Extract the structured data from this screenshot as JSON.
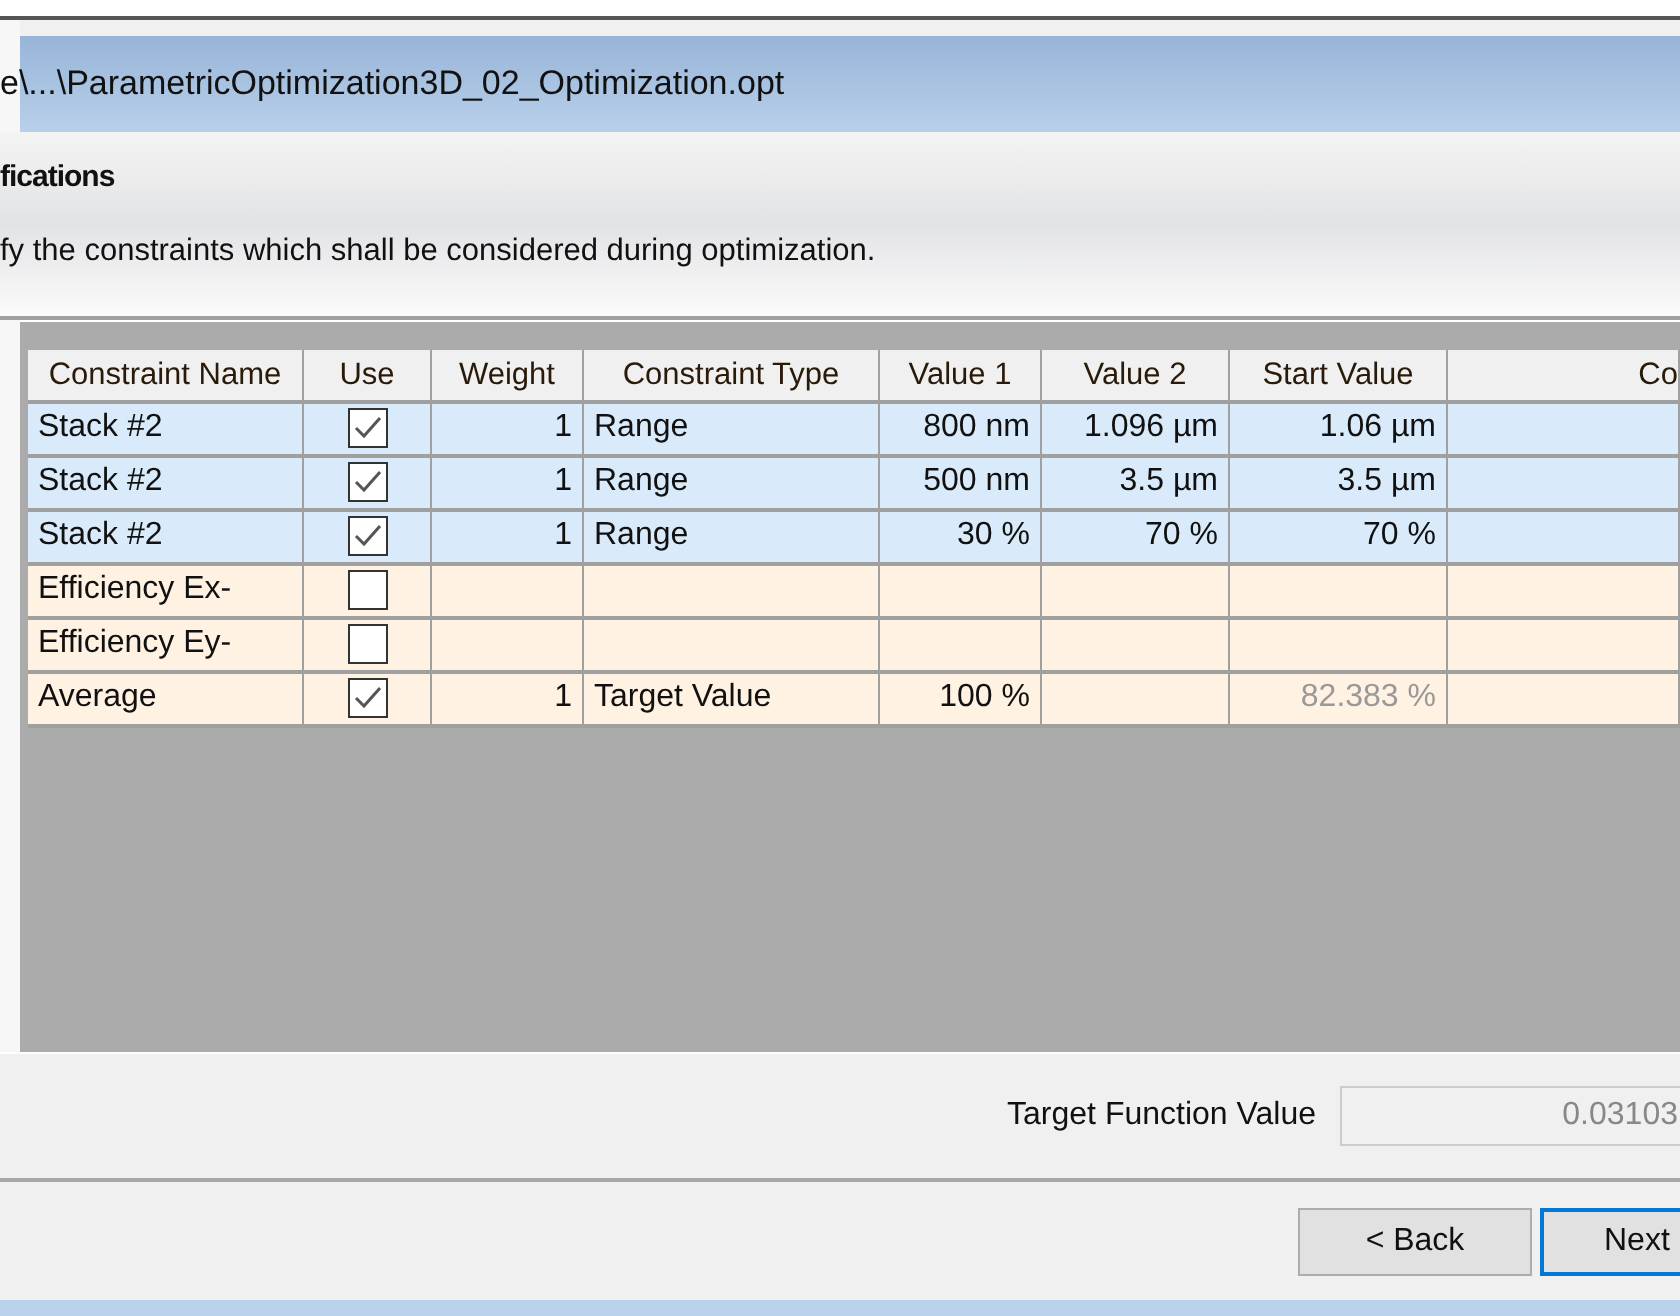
{
  "window": {
    "title": "e\\...\\ParametricOptimization3D_02_Optimization.opt"
  },
  "header": {
    "title": "fications",
    "description": "fy the constraints which shall be considered during optimization."
  },
  "table": {
    "columns": [
      "Constraint Name",
      "Use",
      "Weight",
      "Constraint Type",
      "Value 1",
      "Value 2",
      "Start Value",
      "Co"
    ],
    "rows": [
      {
        "name": "Stack #2",
        "checked": true,
        "weight": "1",
        "type": "Range",
        "value_1": "800 nm",
        "value_2": "1.096 µm",
        "start_value": "1.06 µm",
        "start_value_disabled": false,
        "color": "#d9ebfb"
      },
      {
        "name": "Stack #2",
        "checked": true,
        "weight": "1",
        "type": "Range",
        "value_1": "500 nm",
        "value_2": "3.5 µm",
        "start_value": "3.5 µm",
        "start_value_disabled": false,
        "color": "#d9ebfb"
      },
      {
        "name": "Stack #2",
        "checked": true,
        "weight": "1",
        "type": "Range",
        "value_1": "30 %",
        "value_2": "70 %",
        "start_value": "70 %",
        "start_value_disabled": false,
        "color": "#d9ebfb"
      },
      {
        "name": "Efficiency Ex-",
        "checked": false,
        "color": "#fff2e2"
      },
      {
        "name": "Efficiency Ey-",
        "checked": false,
        "color": "#fff2e2"
      },
      {
        "name": "Average",
        "checked": true,
        "weight": "1",
        "type": "Target Value",
        "value_1": "100 %",
        "start_value": "82.383 %",
        "start_value_disabled": true,
        "color": "#fff2e2"
      }
    ]
  },
  "target_function": {
    "label": "Target Function Value",
    "value": "0.03103"
  },
  "buttons": [
    "< Back",
    "Next"
  ]
}
